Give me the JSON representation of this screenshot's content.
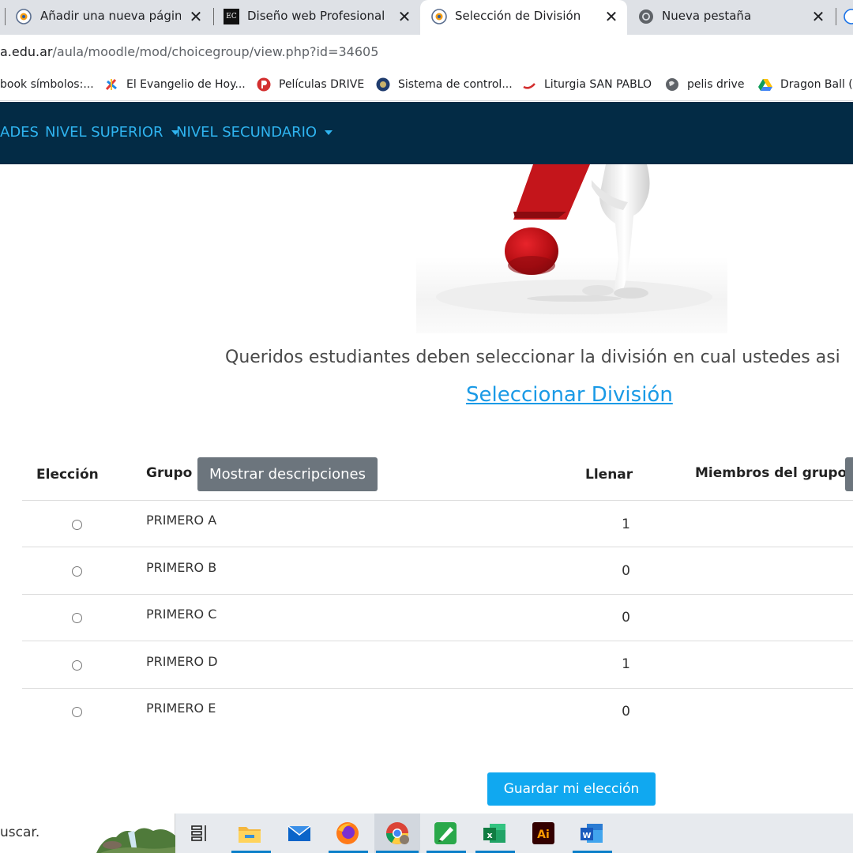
{
  "browser": {
    "tabs": [
      {
        "title": "Añadir una nueva página <"
      },
      {
        "title": "Diseño web Profesional con"
      },
      {
        "title": "Selección de División"
      },
      {
        "title": "Nueva pestaña"
      }
    ],
    "fav_ec_label": "EC",
    "close_glyph": "✕",
    "url_host": "a.edu.ar",
    "url_path": "/aula/moodle/mod/choicegroup/view.php?id=34605",
    "bookmarks": [
      {
        "label": "book símbolos:..."
      },
      {
        "label": "El Evangelio de Hoy..."
      },
      {
        "label": "Películas DRIVE"
      },
      {
        "label": "Sistema de control..."
      },
      {
        "label": "Liturgia SAN PABLO"
      },
      {
        "label": "pelis drive"
      },
      {
        "label": "Dragon Ball (L"
      }
    ]
  },
  "navbar": {
    "items": [
      {
        "label": "ADES"
      },
      {
        "label": "NIVEL SUPERIOR"
      },
      {
        "label": "NIVEL SECUNDARIO"
      }
    ]
  },
  "content": {
    "intro_text": "Queridos estudiantes deben seleccionar la división en cual ustedes asi",
    "select_link": "Seleccionar División"
  },
  "table": {
    "headers": {
      "choice": "Elección",
      "group": "Grupo",
      "show_descriptions": "Mostrar descripciones",
      "fill": "Llenar",
      "members": "Miembros del grupo"
    },
    "rows": [
      {
        "group": "PRIMERO A",
        "fill": "1"
      },
      {
        "group": "PRIMERO B",
        "fill": "0"
      },
      {
        "group": "PRIMERO C",
        "fill": "0"
      },
      {
        "group": "PRIMERO D",
        "fill": "1"
      },
      {
        "group": "PRIMERO E",
        "fill": "0"
      }
    ],
    "save_button": "Guardar mi elección"
  },
  "taskbar": {
    "search_text": "uscar.",
    "apps": [
      "task-view",
      "file-explorer",
      "mail",
      "firefox",
      "chrome",
      "drawing-app",
      "excel",
      "illustrator",
      "word"
    ],
    "illustrator_label": "Ai",
    "excel_label": "x",
    "word_label": "W"
  },
  "colors": {
    "navbar_bg": "#032b45",
    "nav_link": "#2fb4f0",
    "primary_button": "#10a8f0",
    "secondary_button": "#6c757d"
  }
}
